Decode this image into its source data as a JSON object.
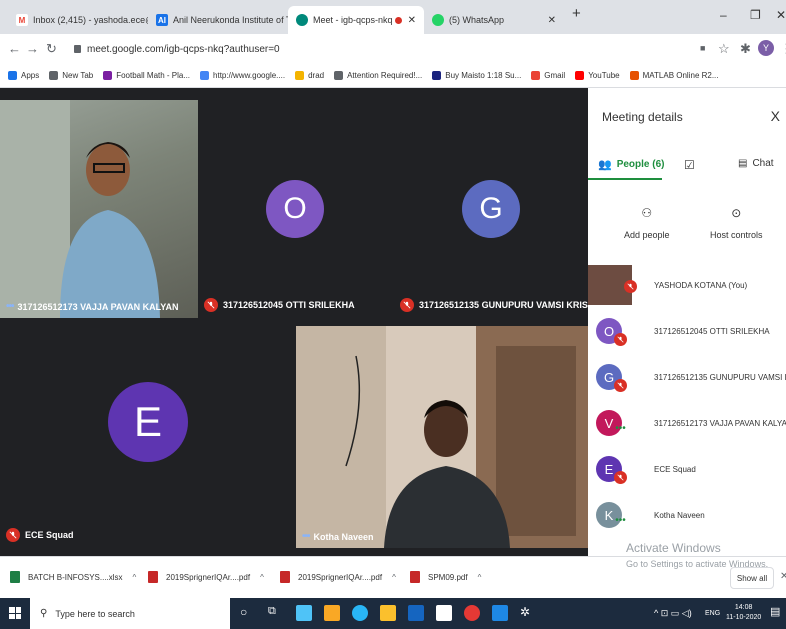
{
  "browser": {
    "tabs": [
      {
        "label": "Inbox (2,415) - yashoda.ece@an",
        "favicon_color": "#ea4335",
        "favicon_text": "M"
      },
      {
        "label": "Anil Neerukonda Institute of Tec",
        "favicon_color": "#1a73e8",
        "favicon_text": "AI"
      },
      {
        "label": "Meet - igb-qcps-nkq",
        "favicon_color": "#00897b",
        "favicon_text": "",
        "active": true
      },
      {
        "label": "(5) WhatsApp",
        "favicon_color": "#25d366",
        "favicon_text": ""
      }
    ],
    "new_tab": "+",
    "url": "meet.google.com/igb-qcps-nkq?authuser=0",
    "profile_initial": "Y"
  },
  "bookmarks": [
    {
      "label": "Apps",
      "color": "#1a73e8"
    },
    {
      "label": "New Tab",
      "color": "#5f6368"
    },
    {
      "label": "Football Math - Pla...",
      "color": "#7b1fa2"
    },
    {
      "label": "http://www.google....",
      "color": "#4285f4"
    },
    {
      "label": "drad",
      "color": "#f4b400"
    },
    {
      "label": "Attention Required!...",
      "color": "#5f6368"
    },
    {
      "label": "Buy Maisto 1:18 Su...",
      "color": "#1a237e"
    },
    {
      "label": "Gmail",
      "color": "#ea4335"
    },
    {
      "label": "YouTube",
      "color": "#ff0000"
    },
    {
      "label": "MATLAB Online R2...",
      "color": "#e65100"
    }
  ],
  "tiles": [
    {
      "name": "317126512173 VAJJA PAVAN KALYAN",
      "type": "video",
      "speaking": true
    },
    {
      "name": "317126512045 OTTI SRILEKHA",
      "initial": "O",
      "color": "#7e57c2",
      "muted": true
    },
    {
      "name": "317126512135 GUNUPURU VAMSI KRISHNA",
      "initial": "G",
      "color": "#5c6bc0",
      "muted": true
    },
    {
      "name": "ECE Squad",
      "initial": "E",
      "color": "#5e35b1",
      "muted": true
    },
    {
      "name": "Kotha Naveen",
      "type": "video",
      "speaking": true
    }
  ],
  "panel": {
    "title": "Meeting details",
    "close": "X",
    "people_tab": "People (6)",
    "chat_tab": "Chat",
    "add_people": "Add people",
    "host_controls": "Host controls",
    "people": [
      {
        "name": "YASHODA KOTANA (You)",
        "initial": "",
        "color": "#6d4c41",
        "muted": true
      },
      {
        "name": "317126512045 OTTI SRILEKHA",
        "initial": "O",
        "color": "#7e57c2",
        "muted": true
      },
      {
        "name": "317126512135 GUNUPURU VAMSI K...",
        "initial": "G",
        "color": "#5c6bc0",
        "muted": true
      },
      {
        "name": "317126512173 VAJJA PAVAN KALYAN",
        "initial": "V",
        "color": "#c2185b",
        "muted": false
      },
      {
        "name": "ECE Squad",
        "initial": "E",
        "color": "#5e35b1",
        "muted": true
      },
      {
        "name": "Kotha Naveen",
        "initial": "K",
        "color": "#78909c",
        "muted": false
      }
    ],
    "watermark": "Activate Windows"
  },
  "downloads": {
    "items": [
      {
        "label": "BATCH B-INFOSYS....xlsx",
        "color": "#1e7e45"
      },
      {
        "label": "2019SprignerIQAr....pdf",
        "color": "#c62828"
      },
      {
        "label": "2019SprignerIQAr....pdf",
        "color": "#c62828"
      },
      {
        "label": "SPM09.pdf",
        "color": "#c62828"
      }
    ],
    "show_all": "Show all",
    "watermark": "Go to Settings to activate Windows."
  },
  "taskbar": {
    "search_placeholder": "Type here to search",
    "lang": "ENG",
    "time": "14:08",
    "date": "11-10-2020"
  }
}
